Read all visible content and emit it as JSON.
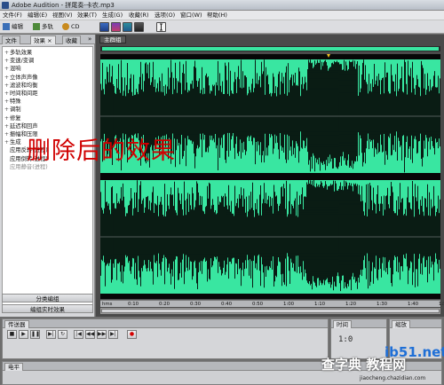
{
  "titlebar": {
    "title": "Adobe Audition - 拼尾奏-卡农.mp3"
  },
  "menubar": {
    "items": [
      "文件(F)",
      "编辑(E)",
      "视图(V)",
      "效果(T)",
      "生成(G)",
      "收藏(R)",
      "选项(O)",
      "窗口(W)",
      "帮助(H)"
    ]
  },
  "toolbar": {
    "edit_label": "编辑",
    "multitrack_label": "多轨",
    "cd_label": "CD"
  },
  "left_panel": {
    "tabs": [
      "文件",
      "效果",
      "收藏"
    ],
    "tree_items": [
      {
        "label": "多轨效果",
        "dim": false
      },
      {
        "label": "变速/变调",
        "dim": false
      },
      {
        "label": "混响",
        "dim": false
      },
      {
        "label": "立体声声像",
        "dim": false
      },
      {
        "label": "滤波和均衡",
        "dim": false
      },
      {
        "label": "时间和间距",
        "dim": false
      },
      {
        "label": "特殊",
        "dim": false
      },
      {
        "label": "调制",
        "dim": false
      },
      {
        "label": "修复",
        "dim": false
      },
      {
        "label": "延迟和回声",
        "dim": false
      },
      {
        "label": "振幅和压限",
        "dim": false
      },
      {
        "label": "生成",
        "dim": false
      },
      {
        "label": "应用反转(进程)",
        "dim": false
      },
      {
        "label": "应用倒转(进程)",
        "dim": false
      },
      {
        "label": "应用静音(进程)",
        "dim": true
      }
    ],
    "btn_category": "分类编组",
    "btn_realtime": "编组实时效果"
  },
  "main_panel": {
    "tab_label": "主群组",
    "overlay_text": "删除后的效果",
    "ruler_ticks": [
      "hms",
      "0:10",
      "0:20",
      "0:30",
      "0:40",
      "0:50",
      "1:00",
      "1:10",
      "1:20",
      "1:30",
      "1:40",
      "1:50"
    ],
    "waveform_color": "#39e6a1"
  },
  "transport": {
    "tab_label": "传送器",
    "buttons": [
      "stop-icon",
      "play-icon",
      "pause-icon",
      "play-from-cursor-icon",
      "loop-icon",
      "skip-start-icon",
      "rewind-icon",
      "fast-forward-icon",
      "skip-end-icon",
      "record-icon"
    ]
  },
  "time_panel": {
    "tab_label": "时间",
    "time_text": "1:0"
  },
  "zoom_panel": {
    "tab_label": "缩放"
  },
  "level_panel": {
    "tab_label": "电平"
  },
  "watermarks": {
    "brand": "ib51.net",
    "site_cn": "查字典 教程网",
    "url": "jiaocheng.chazidian.com"
  }
}
